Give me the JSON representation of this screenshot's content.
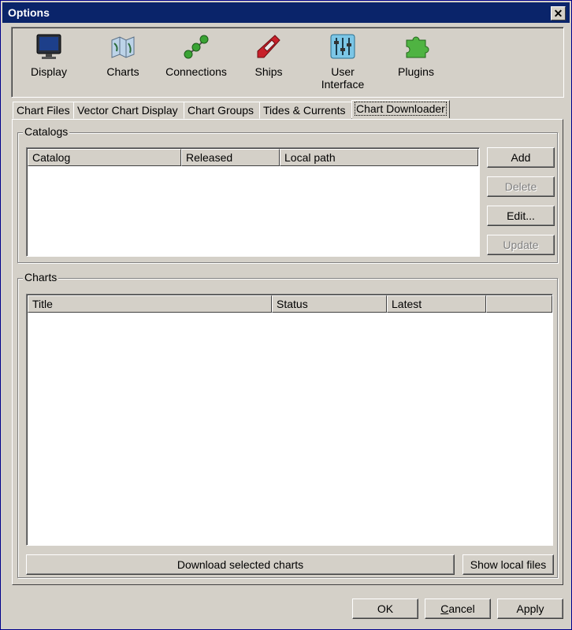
{
  "window": {
    "title": "Options",
    "close_symbol": "✕"
  },
  "toolbar": {
    "items": [
      {
        "label": "Display",
        "icon": "monitor-icon",
        "selected": false
      },
      {
        "label": "Charts",
        "icon": "charts-icon",
        "selected": true
      },
      {
        "label": "Connections",
        "icon": "connections-icon",
        "selected": false
      },
      {
        "label": "Ships",
        "icon": "ship-icon",
        "selected": false
      },
      {
        "label": "User\nInterface",
        "label_line1": "User",
        "label_line2": "Interface",
        "icon": "sliders-icon",
        "selected": false
      },
      {
        "label": "Plugins",
        "icon": "puzzle-piece-icon",
        "selected": false
      }
    ]
  },
  "tabs": [
    {
      "label": "Chart Files"
    },
    {
      "label": "Vector Chart Display"
    },
    {
      "label": "Chart Groups"
    },
    {
      "label": "Tides & Currents"
    },
    {
      "label": "Chart Downloader",
      "active": true
    }
  ],
  "catalogs": {
    "group_label": "Catalogs",
    "columns": [
      "Catalog",
      "Released",
      "Local path"
    ],
    "rows": [],
    "buttons": {
      "add": "Add",
      "delete": "Delete",
      "edit": "Edit...",
      "update": "Update"
    }
  },
  "charts": {
    "group_label": "Charts",
    "columns": [
      "Title",
      "Status",
      "Latest"
    ],
    "rows": [],
    "download_button": "Download selected charts",
    "show_local_button": "Show local files"
  },
  "footer": {
    "ok": "OK",
    "cancel_pre": "",
    "cancel_u": "C",
    "cancel_post": "ancel",
    "apply": "Apply"
  },
  "colors": {
    "title_bar": "#0a246a",
    "face": "#d4d0c8",
    "selection": "#0a246a"
  }
}
